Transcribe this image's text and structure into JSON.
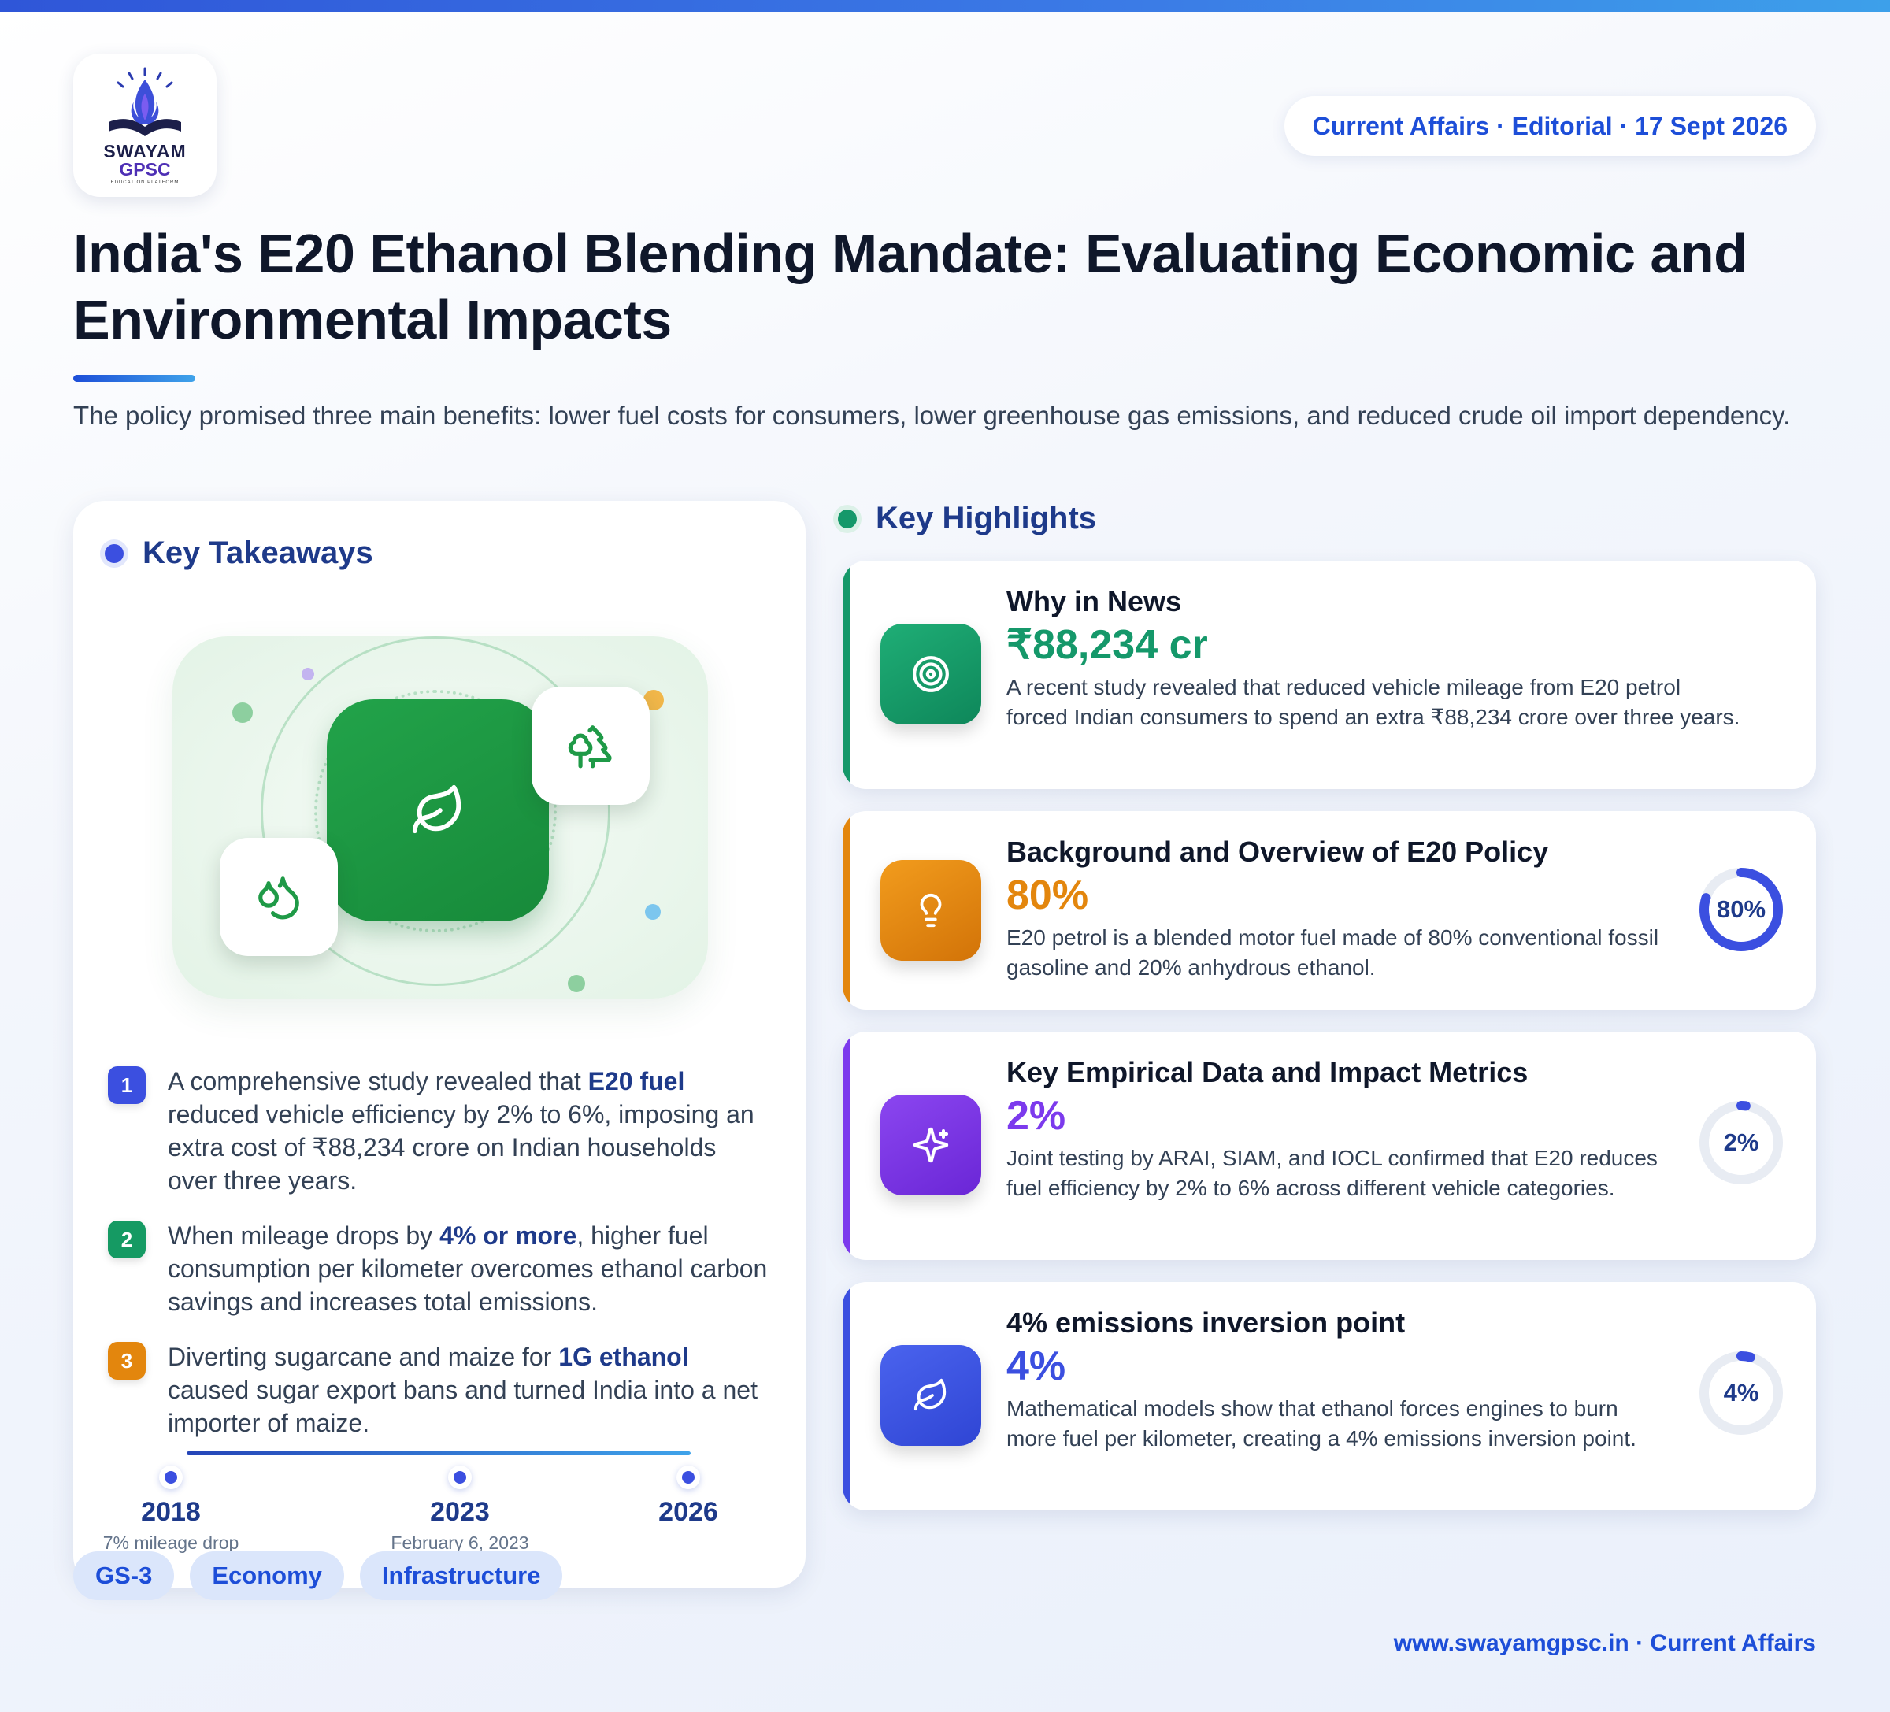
{
  "header": {
    "logo_word": "SWAYAM",
    "logo_sub": "GPSC",
    "logo_tagline": "EDUCATION PLATFORM",
    "date_pill": "Current Affairs · Editorial · 17 Sept 2026"
  },
  "title": "India's E20 Ethanol Blending Mandate: Evaluating Economic and Environmental Impacts",
  "subtitle": "The policy promised three main benefits: lower fuel costs for consumers, lower greenhouse gas emissions, and reduced crude oil import dependency.",
  "takeaways": {
    "heading": "Key Takeaways",
    "items": [
      {
        "num": "1",
        "pre": "A comprehensive study revealed that ",
        "bold": "E20 fuel",
        "post": " reduced vehicle efficiency by 2% to 6%, imposing an extra cost of ₹88,234 crore on Indian households over three years.",
        "color": "#3b4fe0"
      },
      {
        "num": "2",
        "pre": "When mileage drops by ",
        "bold": "4% or more",
        "post": ", higher fuel consumption per kilometer overcomes ethanol carbon savings and increases total emissions.",
        "color": "#159a63"
      },
      {
        "num": "3",
        "pre": "Diverting sugarcane and maize for ",
        "bold": "1G ethanol",
        "post": " caused sugar export bans and turned India into a net importer of maize.",
        "color": "#e3860d"
      }
    ],
    "timeline": [
      {
        "year": "2018",
        "note": "7% mileage drop"
      },
      {
        "year": "2023",
        "note": "February 6, 2023"
      },
      {
        "year": "2026",
        "note": ""
      }
    ],
    "icons": [
      "leaf-icon",
      "trees-icon",
      "droplets-icon"
    ]
  },
  "highlights": {
    "heading": "Key Highlights",
    "cards": [
      {
        "title": "Why in News",
        "big": "₹88,234 cr",
        "text": "A recent study revealed that reduced vehicle mileage from E20 petrol forced Indian consumers to spend an extra ₹88,234 crore over three years.",
        "accent": "#15986a",
        "icon": "target-icon"
      },
      {
        "title": "Background and Overview of E20 Policy",
        "big": "80%",
        "text": "E20 petrol is a blended motor fuel made of 80% conventional fossil gasoline and 20% anhydrous ethanol.",
        "accent": "#e3860d",
        "icon": "lightbulb-icon",
        "gauge_label": "80%",
        "gauge_value": 0.8
      },
      {
        "title": "Key Empirical Data and Impact Metrics",
        "big": "2%",
        "text": "Joint testing by ARAI, SIAM, and IOCL confirmed that E20 reduces fuel efficiency by 2% to 6% across different vehicle categories.",
        "accent": "#7c3aed",
        "icon": "sparkles-icon",
        "gauge_label": "2%",
        "gauge_value": 0.02
      },
      {
        "title": "4% emissions inversion point",
        "big": "4%",
        "text": "Mathematical models show that ethanol forces engines to burn more fuel per kilometer, creating a 4% emissions inversion point.",
        "accent": "#3b4fe0",
        "icon": "leaf-icon",
        "gauge_label": "4%",
        "gauge_value": 0.04
      }
    ]
  },
  "tags": [
    "GS-3",
    "Economy",
    "Infrastructure"
  ],
  "footer_url": "www.swayamgpsc.in · Current Affairs",
  "colors": {
    "brand_blue": "#1d4ed8",
    "navy": "#1e3a8a",
    "green": "#15986a",
    "amber": "#e3860d",
    "purple": "#7c3aed",
    "indigo": "#3b4fe0"
  }
}
